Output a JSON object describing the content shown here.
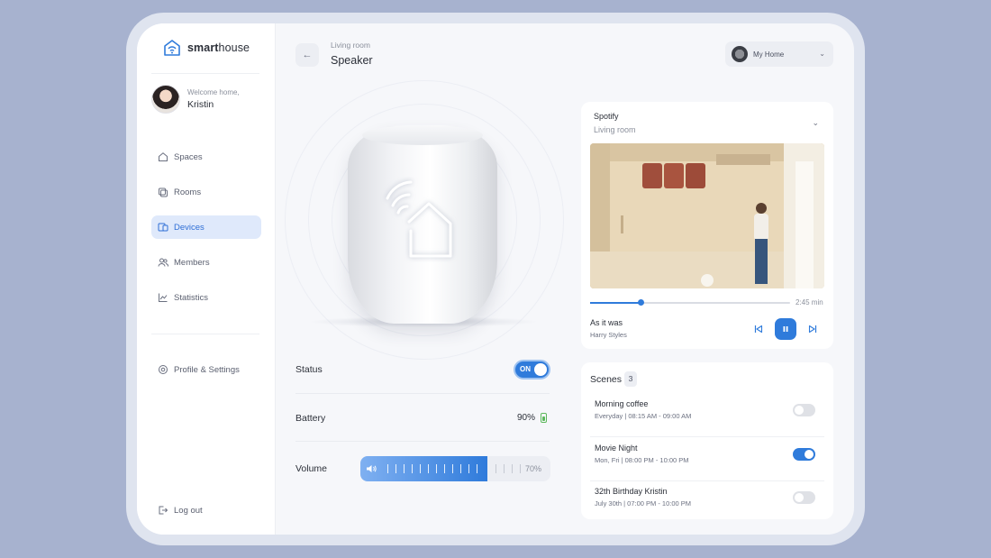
{
  "brand": {
    "name_bold": "smart",
    "name_light": "house"
  },
  "user": {
    "greeting": "Welcome home,",
    "name": "Kristin"
  },
  "nav": {
    "items": [
      {
        "label": "Spaces",
        "icon": "home-icon"
      },
      {
        "label": "Rooms",
        "icon": "rooms-icon"
      },
      {
        "label": "Devices",
        "icon": "devices-icon",
        "active": true
      },
      {
        "label": "Members",
        "icon": "members-icon"
      },
      {
        "label": "Statistics",
        "icon": "statistics-icon"
      }
    ],
    "settings_label": "Profile & Settings",
    "logout_label": "Log out"
  },
  "header": {
    "breadcrumb": "Living room",
    "title": "Speaker",
    "home_selector": "My Home"
  },
  "device": {
    "status_label": "Status",
    "status_toggle": "ON",
    "battery_label": "Battery",
    "battery_value": "90%",
    "battery_color": "#5cb85c",
    "volume_label": "Volume",
    "volume_value": "70%",
    "volume_level": 0.67
  },
  "player": {
    "source": "Spotify",
    "room": "Living room",
    "song": "As it was",
    "artist": "Harry Styles",
    "duration": "2:45 min",
    "progress": 0.25
  },
  "scenes": {
    "title": "Scenes",
    "count": "3",
    "items": [
      {
        "name": "Morning coffee",
        "days": "Everyday",
        "time": "08:15 AM - 09:00 AM",
        "on": false
      },
      {
        "name": "Movie Night",
        "days": "Mon, Fri",
        "time": "08:00 PM - 10:00 PM",
        "on": true
      },
      {
        "name": "32th Birthday Kristin",
        "days": "July 30th",
        "time": "07:00 PM - 10:00 PM",
        "on": false
      }
    ]
  },
  "colors": {
    "accent": "#2f7bdb",
    "active_bg": "#dfe9fb",
    "background": "#a7b2cf"
  }
}
